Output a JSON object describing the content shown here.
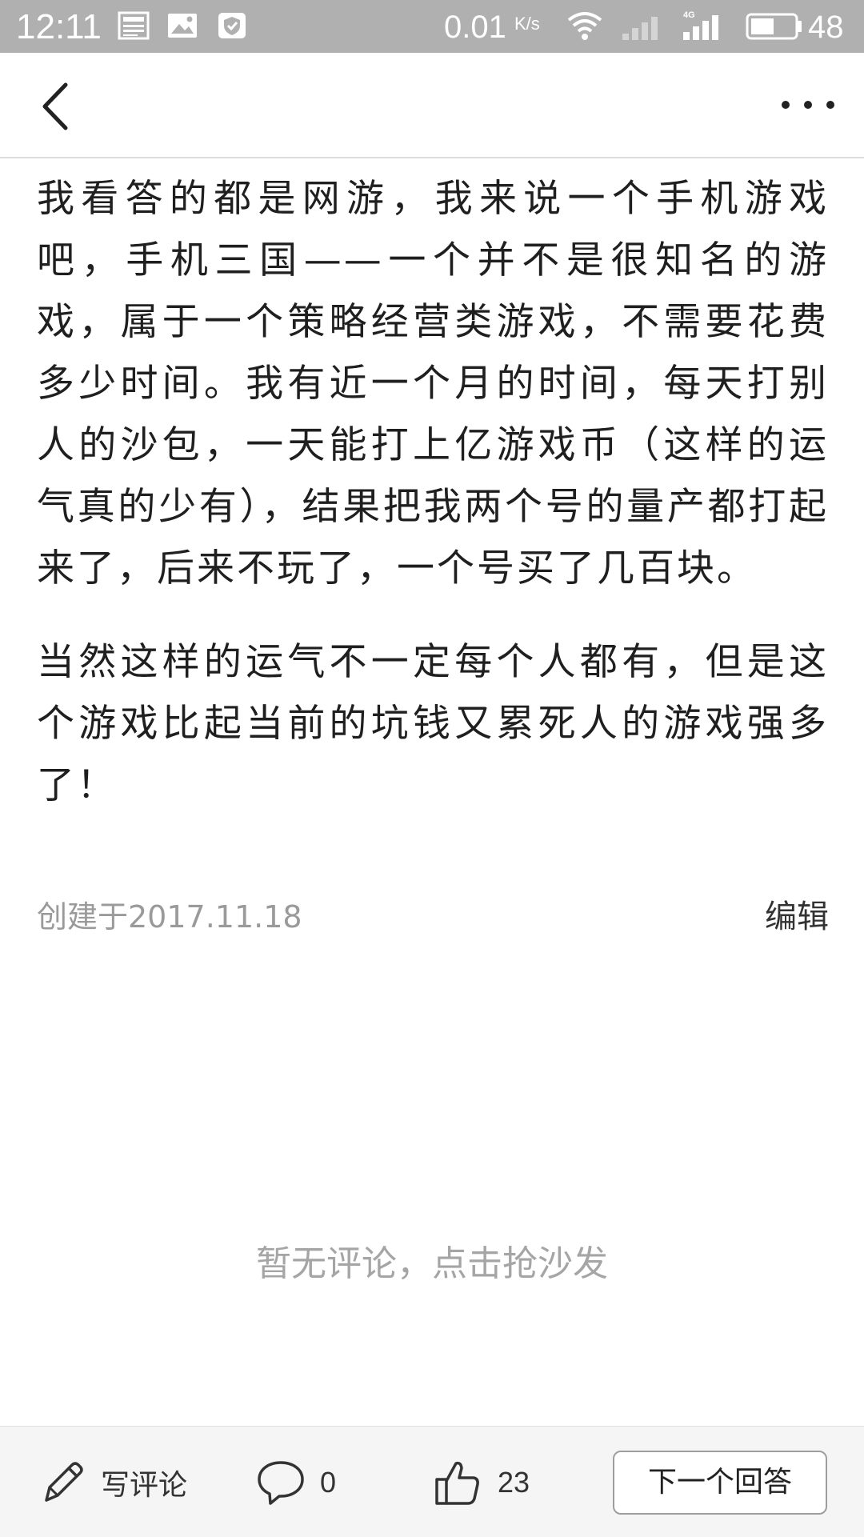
{
  "status_bar": {
    "time": "12:11",
    "notification_icons": [
      "news-icon",
      "gallery-icon",
      "shield-icon"
    ],
    "network_speed": "0.01",
    "network_speed_unit": "K/s",
    "network_type": "4G",
    "battery_level": "48"
  },
  "nav": {
    "back_icon": "chevron-left-icon",
    "more_icon": "more-horizontal-icon"
  },
  "answer": {
    "paragraphs": [
      "我看答的都是网游，我来说一个手机游戏吧，手机三国——一个并不是很知名的游戏，属于一个策略经营类游戏，不需要花费多少时间。我有近一个月的时间，每天打别人的沙包，一天能打上亿游戏币（这样的运气真的少有），结果把我两个号的量产都打起来了，后来不玩了，一个号买了几百块。",
      "当然这样的运气不一定每个人都有，但是这个游戏比起当前的坑钱又累死人的游戏强多了！"
    ],
    "created": "创建于2017.11.18",
    "edit_label": "编辑"
  },
  "comments": {
    "empty_text": "暂无评论，点击抢沙发"
  },
  "toolbar": {
    "write_comment_label": "写评论",
    "comment_count": "0",
    "like_count": "23",
    "next_answer_label": "下一个回答"
  }
}
